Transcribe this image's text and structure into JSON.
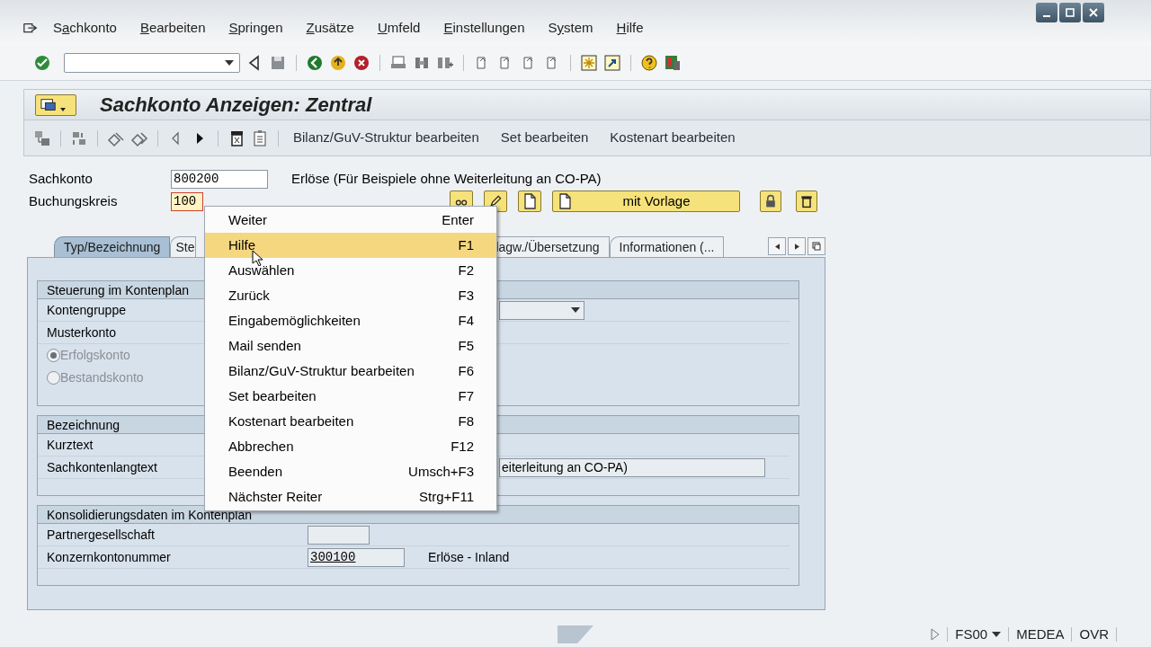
{
  "menu_bar": [
    {
      "prefix": "S",
      "mnemonic": "a",
      "suffix": "chkonto"
    },
    {
      "mnemonic": "B",
      "suffix": "earbeiten"
    },
    {
      "mnemonic": "S",
      "suffix": "pringen"
    },
    {
      "mnemonic": "Z",
      "suffix": "usätze"
    },
    {
      "mnemonic": "U",
      "suffix": "mfeld"
    },
    {
      "mnemonic": "E",
      "suffix": "instellungen"
    },
    {
      "prefix": "S",
      "mnemonic": "y",
      "suffix": "stem"
    },
    {
      "mnemonic": "H",
      "suffix": "ilfe"
    }
  ],
  "title": "Sachkonto Anzeigen: Zentral",
  "app_toolbar": [
    "Bilanz/GuV-Struktur bearbeiten",
    "Set bearbeiten",
    "Kostenart bearbeiten"
  ],
  "header": {
    "sachkonto": {
      "label": "Sachkonto",
      "value": "800200",
      "description": "Erlöse (Für Beispiele ohne Weiterleitung an CO-PA)"
    },
    "buchungskreis": {
      "label": "Buchungskreis",
      "value": "100"
    },
    "template_button": "mit Vorlage"
  },
  "tabs": [
    {
      "label": "Typ/Bezeichnung",
      "selected": true
    },
    {
      "label": "Ste",
      "selected": false
    },
    {
      "label": "lagw./Übersetzung",
      "selected": false
    },
    {
      "label": "Informationen (...",
      "selected": false
    }
  ],
  "groups": [
    {
      "title": "Steuerung im Kontenplan",
      "rows": [
        {
          "kind": "dropdown",
          "label": "Kontengruppe"
        },
        {
          "kind": "text",
          "label": "Musterkonto"
        },
        {
          "kind": "radio",
          "label": "Erfolgskonto",
          "checked": true,
          "disabled": true
        },
        {
          "kind": "radio",
          "label": "Bestandskonto",
          "checked": false,
          "disabled": true
        }
      ]
    },
    {
      "title": "Bezeichnung",
      "rows": [
        {
          "kind": "text",
          "label": "Kurztext"
        },
        {
          "kind": "longfield",
          "label": "Sachkontenlangtext",
          "value": "eiterleitung an CO-PA)"
        }
      ]
    },
    {
      "title": "Konsolidierungsdaten im Kontenplan",
      "rows": [
        {
          "kind": "field",
          "label": "Partnergesellschaft"
        },
        {
          "kind": "field",
          "label": "Konzernkontonummer",
          "value": "300100",
          "description": "Erlöse - Inland"
        }
      ]
    }
  ],
  "context_menu": [
    {
      "label": "Weiter",
      "shortcut": "Enter",
      "selected": false
    },
    {
      "label": "Hilfe",
      "shortcut": "F1",
      "selected": true
    },
    {
      "label": "Auswählen",
      "shortcut": "F2",
      "selected": false
    },
    {
      "label": "Zurück",
      "shortcut": "F3",
      "selected": false
    },
    {
      "label": "Eingabemöglichkeiten",
      "shortcut": "F4",
      "selected": false
    },
    {
      "label": "Mail senden",
      "shortcut": "F5",
      "selected": false
    },
    {
      "label": "Bilanz/GuV-Struktur bearbeiten",
      "shortcut": "F6",
      "selected": false
    },
    {
      "label": "Set bearbeiten",
      "shortcut": "F7",
      "selected": false
    },
    {
      "label": "Kostenart bearbeiten",
      "shortcut": "F8",
      "selected": false
    },
    {
      "label": "Abbrechen",
      "shortcut": "F12",
      "selected": false
    },
    {
      "label": "Beenden",
      "shortcut": "Umsch+F3",
      "selected": false
    },
    {
      "label": "Nächster Reiter",
      "shortcut": "Strg+F11",
      "selected": false
    }
  ],
  "status_bar": {
    "transaction": "FS00",
    "server": "MEDEA",
    "mode": "OVR"
  }
}
